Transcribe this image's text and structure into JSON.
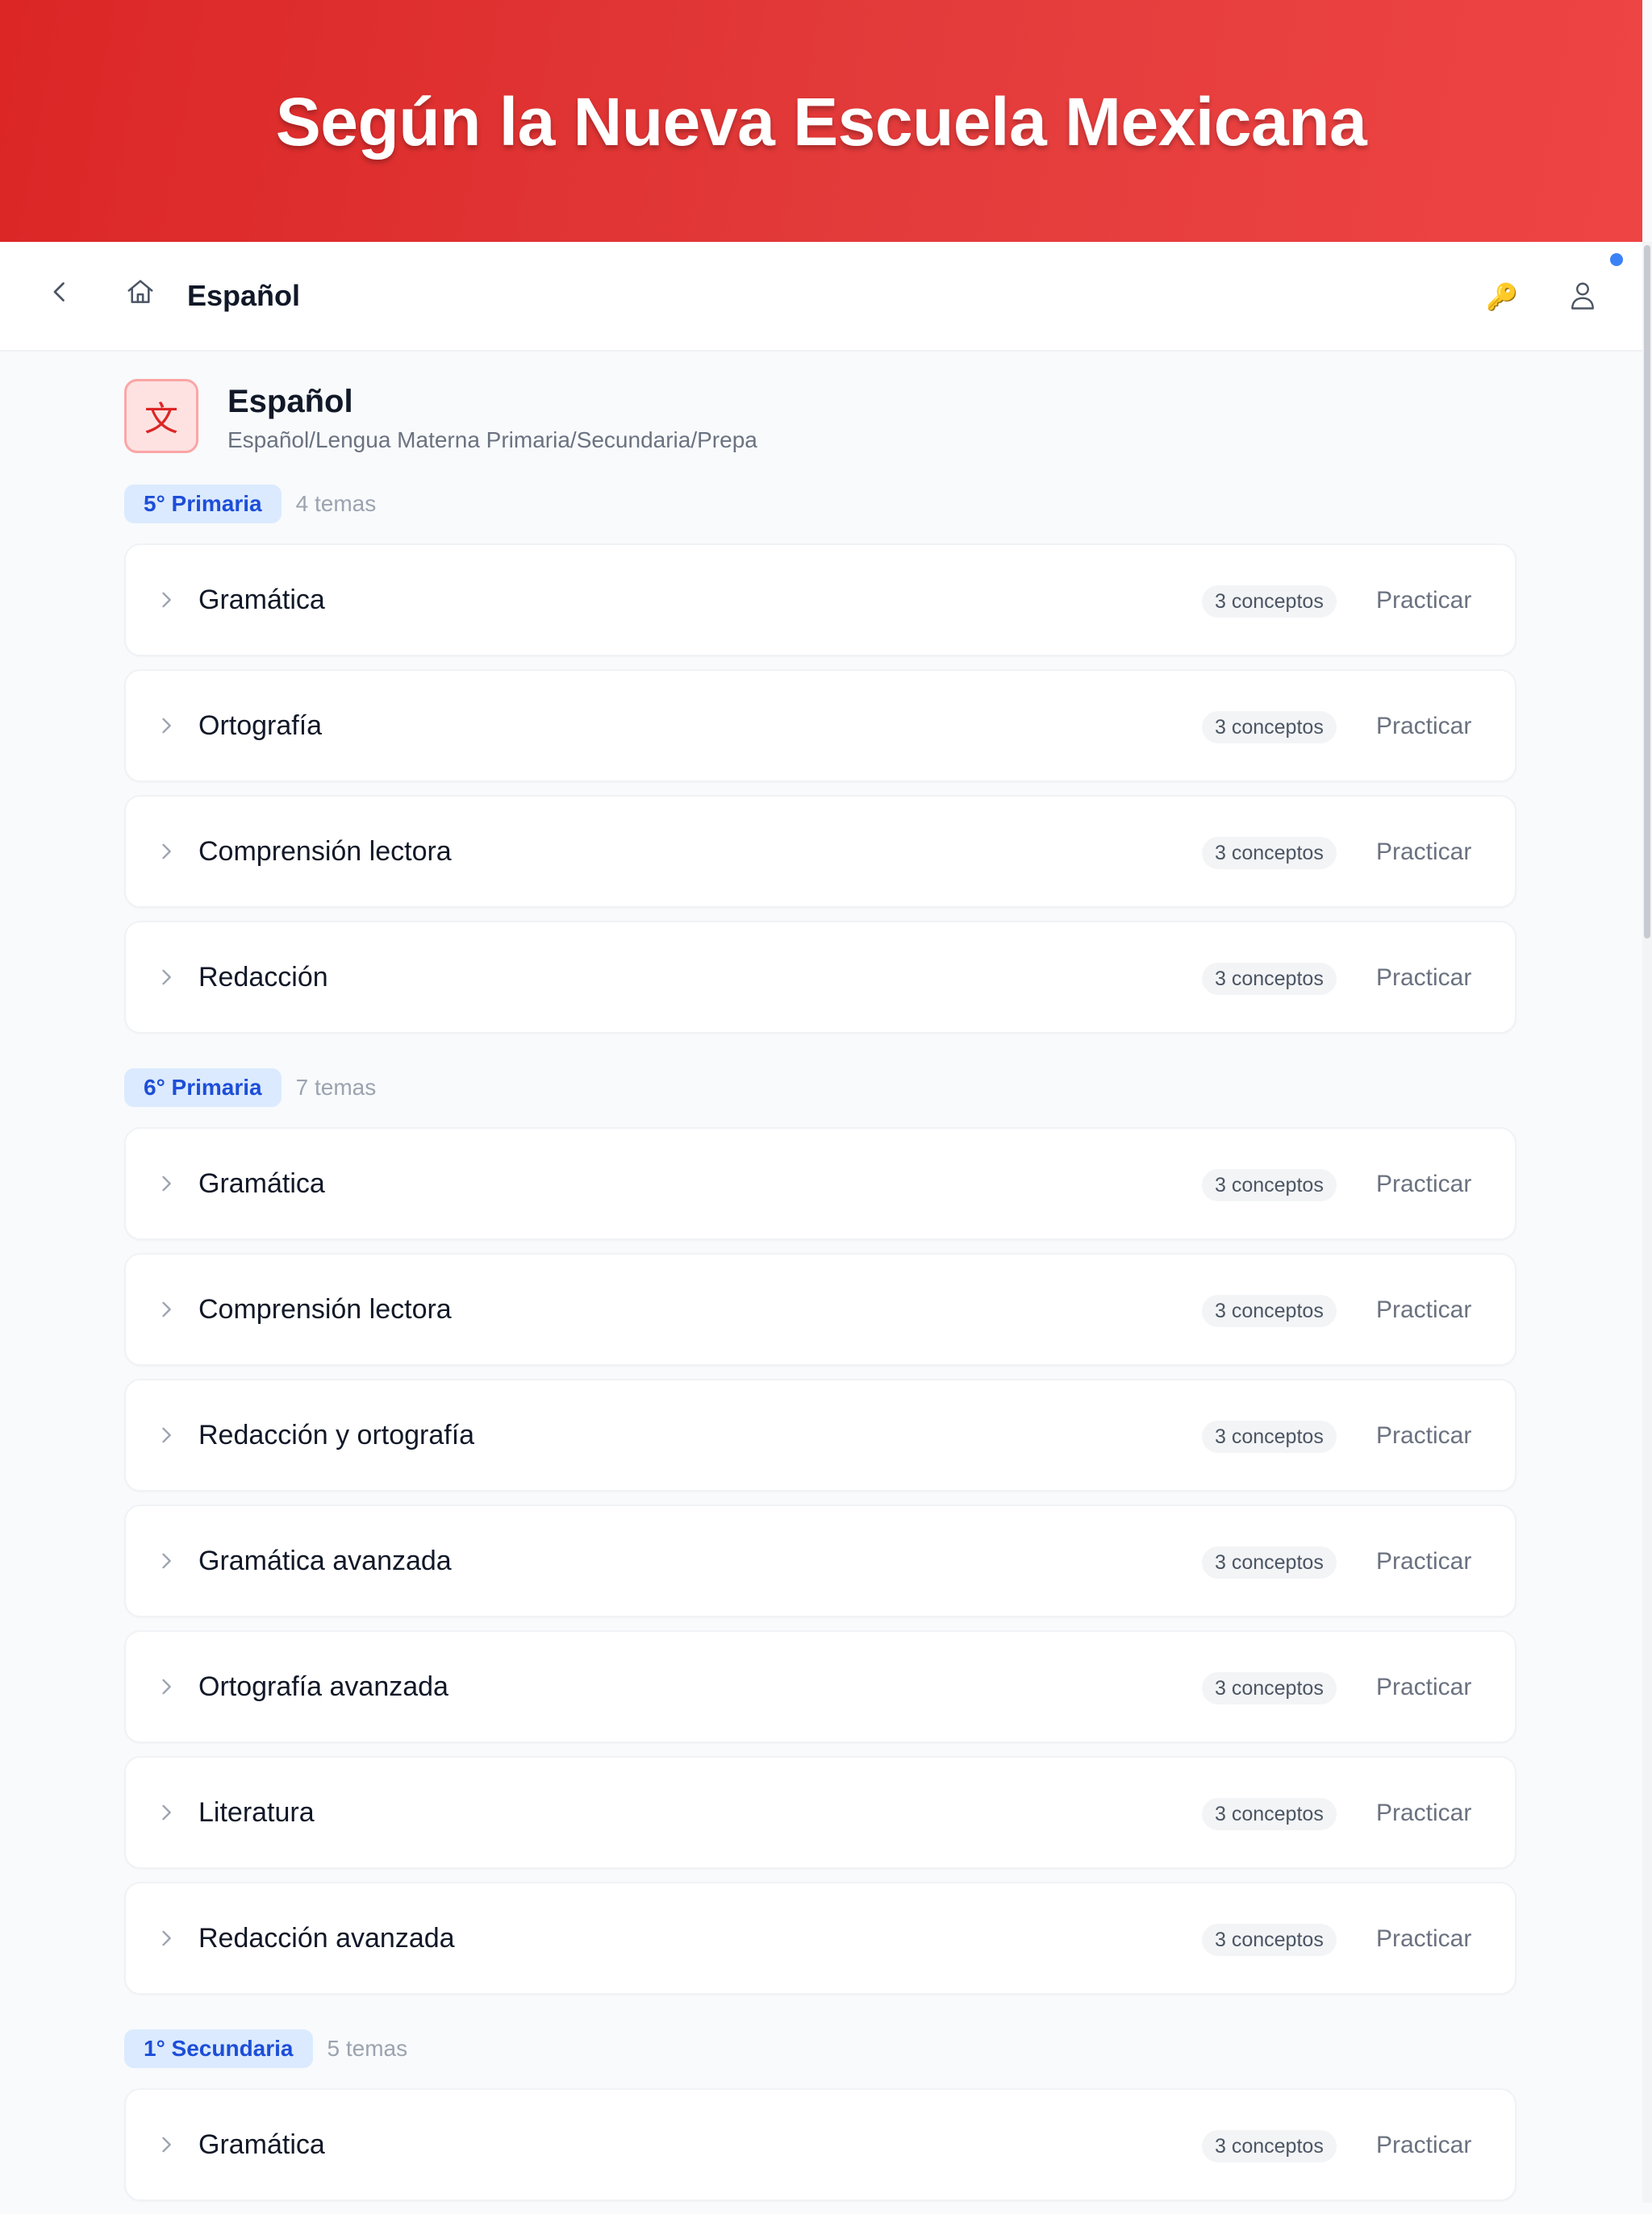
{
  "banner": {
    "title": "Según la Nueva Escuela Mexicana"
  },
  "nav": {
    "title": "Español",
    "icons": [
      "back-chevron-icon",
      "home-icon",
      "key-icon",
      "user-icon"
    ],
    "key_glyph": "🔑"
  },
  "subject": {
    "icon_glyph": "文",
    "name": "Español",
    "description": "Español/Lengua Materna Primaria/Secundaria/Prepa"
  },
  "colors": {
    "accent_red": "#dc2626",
    "pill_blue": "#1d4ed8",
    "notification_dot": "#3b82f6"
  },
  "grades": [
    {
      "label": "5° Primaria",
      "count": "4 temas",
      "topics": [
        {
          "name": "Gramática",
          "concepts": "3 conceptos",
          "action": "Practicar"
        },
        {
          "name": "Ortografía",
          "concepts": "3 conceptos",
          "action": "Practicar"
        },
        {
          "name": "Comprensión lectora",
          "concepts": "3 conceptos",
          "action": "Practicar"
        },
        {
          "name": "Redacción",
          "concepts": "3 conceptos",
          "action": "Practicar"
        }
      ]
    },
    {
      "label": "6° Primaria",
      "count": "7 temas",
      "topics": [
        {
          "name": "Gramática",
          "concepts": "3 conceptos",
          "action": "Practicar"
        },
        {
          "name": "Comprensión lectora",
          "concepts": "3 conceptos",
          "action": "Practicar"
        },
        {
          "name": "Redacción y ortografía",
          "concepts": "3 conceptos",
          "action": "Practicar"
        },
        {
          "name": "Gramática avanzada",
          "concepts": "3 conceptos",
          "action": "Practicar"
        },
        {
          "name": "Ortografía avanzada",
          "concepts": "3 conceptos",
          "action": "Practicar"
        },
        {
          "name": "Literatura",
          "concepts": "3 conceptos",
          "action": "Practicar"
        },
        {
          "name": "Redacción avanzada",
          "concepts": "3 conceptos",
          "action": "Practicar"
        }
      ]
    },
    {
      "label": "1° Secundaria",
      "count": "5 temas",
      "topics": [
        {
          "name": "Gramática",
          "concepts": "3 conceptos",
          "action": "Practicar"
        }
      ]
    }
  ]
}
